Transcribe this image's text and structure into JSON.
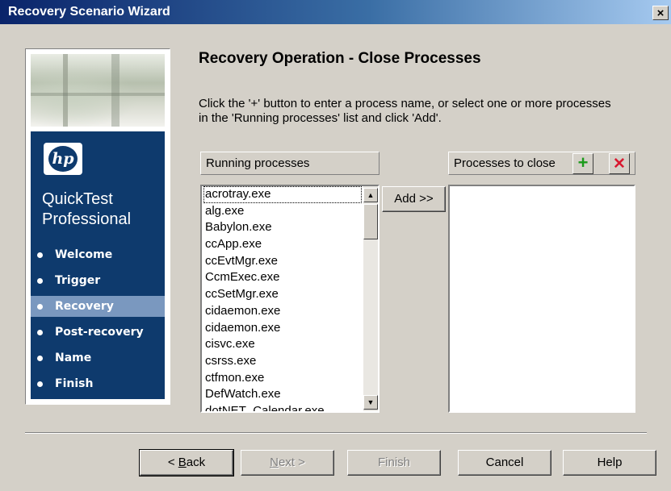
{
  "window": {
    "title": "Recovery Scenario Wizard",
    "close_glyph": "×"
  },
  "sidebar": {
    "brand_logo": "hp",
    "product_line1": "QuickTest",
    "product_line2": "Professional",
    "steps": [
      {
        "label": "Welcome",
        "active": false
      },
      {
        "label": "Trigger",
        "active": false
      },
      {
        "label": "Recovery",
        "active": true
      },
      {
        "label": "Post-recovery",
        "active": false
      },
      {
        "label": "Name",
        "active": false
      },
      {
        "label": "Finish",
        "active": false
      }
    ]
  },
  "main": {
    "heading": "Recovery Operation - Close Processes",
    "instructions": "Click the '+' button to enter a process name, or select one or more processes in the 'Running processes' list and click 'Add'.",
    "running_header": "Running processes",
    "close_header": "Processes to close",
    "add_button": "Add >>",
    "running_processes": [
      "acrotray.exe",
      "alg.exe",
      "Babylon.exe",
      "ccApp.exe",
      "ccEvtMgr.exe",
      "CcmExec.exe",
      "ccSetMgr.exe",
      "cidaemon.exe",
      "cidaemon.exe",
      "cisvc.exe",
      "csrss.exe",
      "ctfmon.exe",
      "DefWatch.exe",
      "dotNET_Calendar.exe"
    ],
    "processes_to_close": [],
    "add_icon": "plus-icon",
    "remove_icon": "red-x-icon"
  },
  "footer": {
    "back": {
      "prefix": "< ",
      "mnemonic": "B",
      "rest": "ack"
    },
    "next": {
      "mnemonic": "N",
      "rest": "ext >"
    },
    "finish": "Finish",
    "cancel": "Cancel",
    "help": "Help"
  }
}
